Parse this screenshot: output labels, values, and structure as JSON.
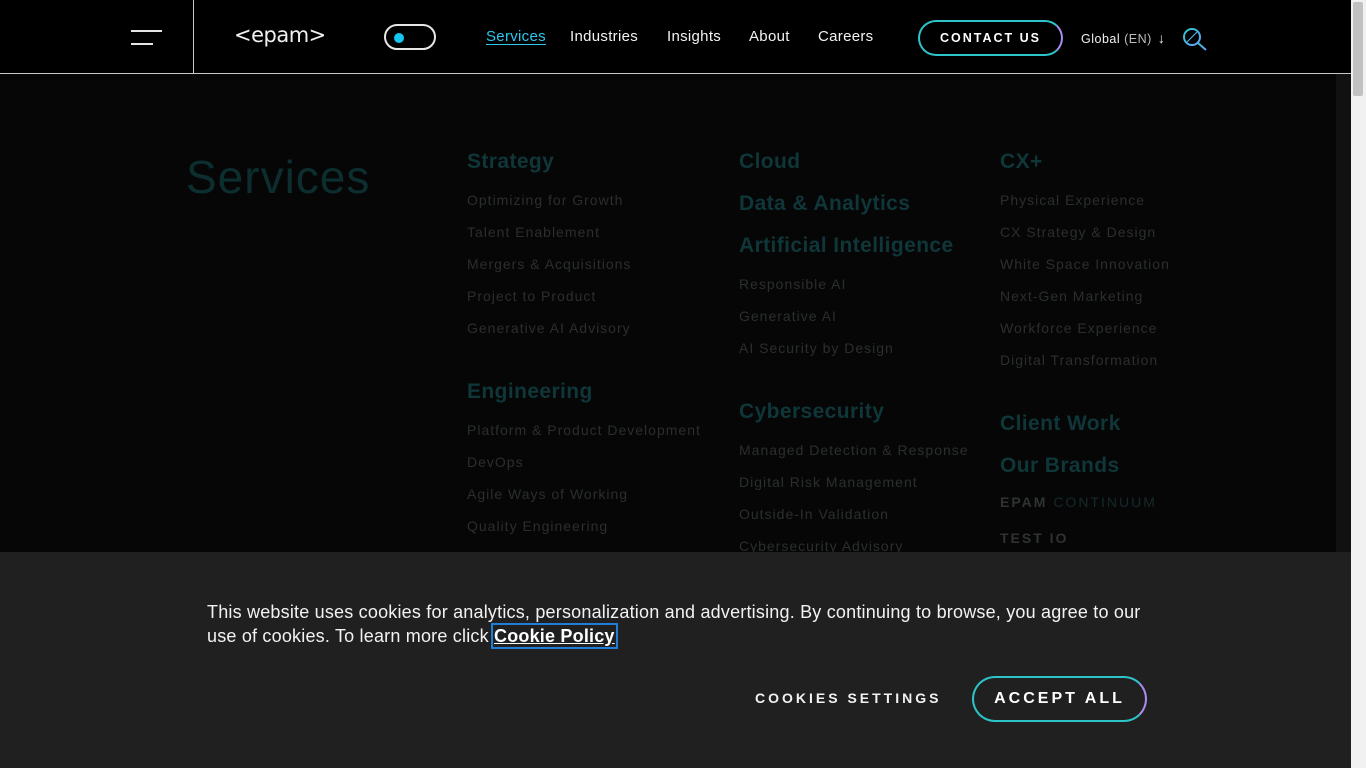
{
  "header": {
    "logo": "<epam>",
    "nav": [
      "Services",
      "Industries",
      "Insights",
      "About",
      "Careers"
    ],
    "contact_label": "CONTACT US",
    "lang_label": "Global",
    "lang_code": "(EN)",
    "lang_arrow": "↓"
  },
  "menu": {
    "title": "Services",
    "strategy": {
      "heading": "Strategy",
      "items": [
        "Optimizing for Growth",
        "Talent Enablement",
        "Mergers & Acquisitions",
        "Project to Product",
        "Generative AI Advisory"
      ]
    },
    "engineering": {
      "heading": "Engineering",
      "items": [
        "Platform & Product Development",
        "DevOps",
        "Agile Ways of Working",
        "Quality Engineering"
      ]
    },
    "cloud": {
      "heading": "Cloud"
    },
    "data_analytics": {
      "heading": "Data & Analytics"
    },
    "ai": {
      "heading": "Artificial Intelligence",
      "items": [
        "Responsible AI",
        "Generative AI",
        "AI Security by Design"
      ]
    },
    "cybersecurity": {
      "heading": "Cybersecurity",
      "items": [
        "Managed Detection & Response",
        "Digital Risk Management",
        "Outside-In Validation",
        "Cybersecurity Advisory"
      ]
    },
    "cx": {
      "heading": "CX+",
      "items": [
        "Physical Experience",
        "CX Strategy & Design",
        "White Space Innovation",
        "Next-Gen Marketing",
        "Workforce Experience",
        "Digital Transformation"
      ]
    },
    "client_work": {
      "heading": "Client Work"
    },
    "our_brands": {
      "heading": "Our Brands",
      "brand1_a": "EPAM",
      "brand1_b": "CONTINUUM",
      "brand2": "TEST IO"
    }
  },
  "cookie": {
    "text": "This website uses cookies for analytics, personalization and advertising. By continuing to browse, you agree to our use of cookies. To learn more click ",
    "policy_link": "Cookie Policy",
    "settings_label": "COOKIES SETTINGS",
    "accept_label": "ACCEPT ALL"
  },
  "colors": {
    "accent": "#2ec7ee",
    "toggle_knob": "#14c7f2",
    "button_gradient_start": "#2cc4c8",
    "button_gradient_end": "#a98cf0"
  }
}
